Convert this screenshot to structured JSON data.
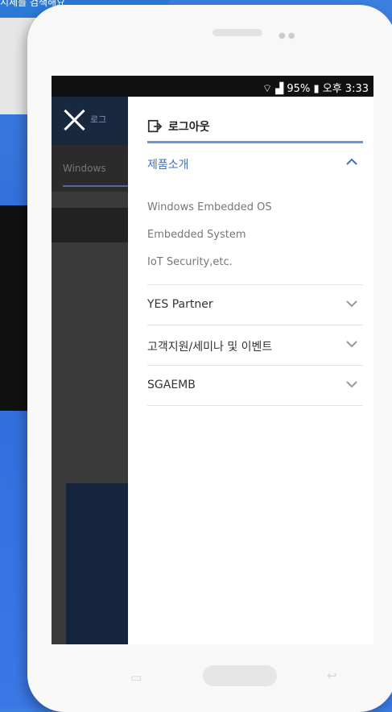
{
  "background": {
    "top_snippet": "시세를 검색해요"
  },
  "status_bar": {
    "signal": "95%",
    "time": "오후 3:33"
  },
  "behind_app": {
    "header_text": "로그",
    "tab_label": "Windows"
  },
  "drawer": {
    "logout_label": "로그아웃",
    "menu": [
      {
        "label": "제품소개",
        "expanded": true,
        "subitems": [
          "Windows Embedded OS",
          "Embedded System",
          "IoT Security,etc."
        ]
      },
      {
        "label": "YES Partner",
        "expanded": false
      },
      {
        "label": "고객지원/세미나 및 이벤트",
        "expanded": false
      },
      {
        "label": "SGAEMB",
        "expanded": false
      }
    ]
  },
  "colors": {
    "accent": "#3d6fc8",
    "header_navy": "#17283f",
    "background_blue": "#2f6cd8"
  }
}
